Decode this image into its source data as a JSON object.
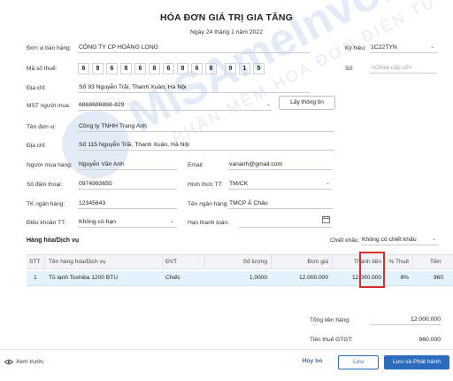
{
  "invoice": {
    "title": "HÓA ĐƠN GIÁ TRỊ GIA TĂNG",
    "date": "Ngày 24 tháng 1 năm 2022"
  },
  "seller": {
    "name_label": "Đơn vị bán hàng:",
    "name_value": "CÔNG TY CP HOÀNG LONG",
    "tax_label": "Mã số thuế:",
    "tax_digits": [
      "6",
      "8",
      "6",
      "8",
      "6",
      "8",
      "6",
      "8",
      "6",
      "8",
      "9",
      "1",
      "5"
    ],
    "address_label": "Địa chỉ:",
    "address_value": "Số 93 Nguyễn Trãi, Thanh Xuân, Hà Nội"
  },
  "symbol": {
    "label": "Ký hiệu:",
    "value": "1C22TYN",
    "number_label": "Số:",
    "number_placeholder": "<Chưa cấp số>"
  },
  "buyer": {
    "mst_label": "MST người mua:",
    "mst_value": "6868686868-829",
    "lookup_button": "Lấy thông tin",
    "unit_label": "Tên đơn vị:",
    "unit_value": "Công ty TNHH Trang Anh",
    "address_label": "Địa chỉ:",
    "address_value": "Số 115 Nguyễn Trãi, Thanh Xuân, Hà Nội",
    "person_label": "Người mua hàng:",
    "person_value": "Nguyễn Văn Anh",
    "email_label": "Email:",
    "email_value": "vananh@gmail.com",
    "phone_label": "Số điện thoại:",
    "phone_value": "0974993655",
    "payment_label": "Hình thức TT:",
    "payment_value": "TM/CK",
    "bank_acc_label": "TK ngân hàng:",
    "bank_acc_value": "12345643",
    "bank_name_label": "Tên ngân hàng:",
    "bank_name_value": "TMCP Á Châu",
    "terms_label": "Điều khoản TT:",
    "terms_value": "Không có hạn",
    "due_label": "Hạn thanh toán:",
    "due_value": ""
  },
  "items": {
    "section_title": "Hàng hóa/Dịch vụ",
    "discount_label": "Chiết khấu:",
    "discount_value": "Không có chiết khấu",
    "columns": {
      "stt": "STT",
      "name": "Tên hàng hóa/Dịch vụ",
      "unit": "ĐVT",
      "qty": "Số lượng",
      "price": "Đơn giá",
      "amount": "Thành tiền",
      "vat": "% Thuế",
      "tax": "Tiền"
    },
    "rows": [
      {
        "stt": "1",
        "name": "Tủ lạnh Toshiba 1200 BTU",
        "unit": "Chiếc",
        "qty": "1,0000",
        "price": "12.000.000",
        "amount": "12.000.000",
        "vat": "8%",
        "tax": "960"
      }
    ]
  },
  "totals": {
    "total_label": "Tổng tiền hàng:",
    "total_value": "12.000.000",
    "vat_label": "Tiền thuế GTGT:",
    "vat_value": "960.000"
  },
  "footer": {
    "preview_label": "Xem trước",
    "cancel_label": "Hủy bỏ",
    "save_label": "Lưu",
    "save_issue_label": "Lưu và Phát hành"
  },
  "watermark": {
    "main": "MISAmeInvoice",
    "sub": "PHẦN MỀM HÓA ĐƠN ĐIỆN TỬ"
  },
  "colors": {
    "primary": "#2d6bbd",
    "highlight": "#d9302c",
    "selected_row": "#e4f2fb"
  }
}
